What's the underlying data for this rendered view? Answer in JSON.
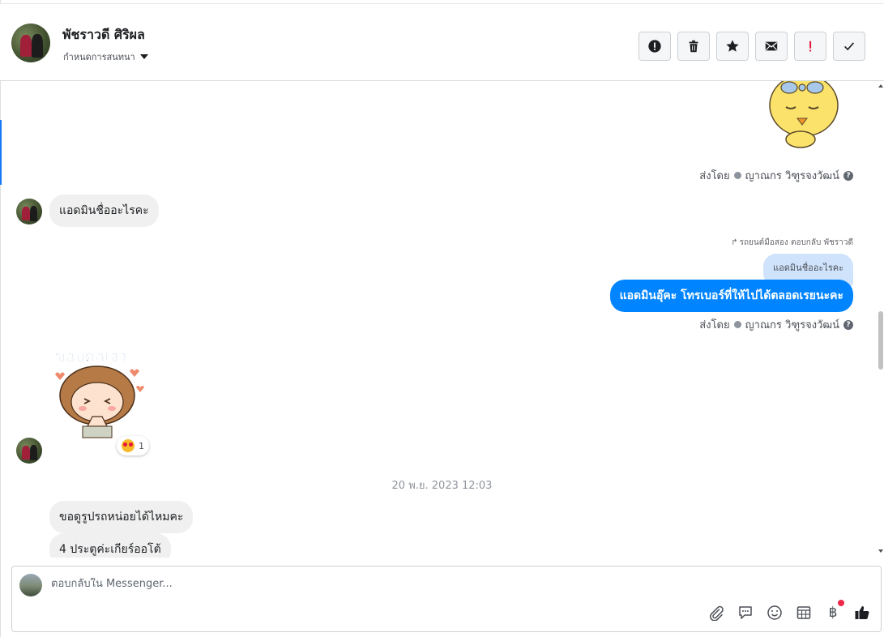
{
  "header": {
    "contact_name": "พัชราวดี ศิริผล",
    "assign_label": "กำหนดการสนทนา",
    "actions": [
      {
        "name": "report-button",
        "icon": "exclamation-circle-icon"
      },
      {
        "name": "delete-button",
        "icon": "trash-icon"
      },
      {
        "name": "star-button",
        "icon": "star-icon"
      },
      {
        "name": "mark-unread-button",
        "icon": "envelope-icon"
      },
      {
        "name": "follow-up-button",
        "icon": "exclamation-mark-icon"
      },
      {
        "name": "mark-done-button",
        "icon": "check-icon"
      }
    ]
  },
  "messages": {
    "sent_by_1": "ส่งโดย",
    "sender_1": "ญาณกร วิฑูรจงวัฒน์",
    "incoming_1": "แอดมินชื่ออะไรคะ",
    "reply_meta": "รถยนต์มือสอง ตอบกลับ พัชราวดี",
    "quoted_text": "แอดมินชื่ออะไรคะ",
    "outgoing_1": "แอดมินอุ๊คะ โทรเบอร์ที่ให้ไปได้ตลอดเรยนะคะ",
    "sent_by_2": "ส่งโดย",
    "sender_2": "ญาณกร วิฑูรจงวัฒน์",
    "sticker_caption": "ขอบคุณจ้า",
    "reaction_count": "1",
    "timestamp": "20 พ.ย. 2023 12:03",
    "incoming_2": "ขอดูรูปรถหน่อยได้ไหมคะ",
    "incoming_3": "4 ประตูค่ะเกียร์ออโต้"
  },
  "composer": {
    "placeholder": "ตอบกลับใน Messenger...",
    "tools": [
      "paperclip-icon",
      "chat-bubble-icon",
      "smiley-icon",
      "calendar-grid-icon",
      "baht-icon",
      "thumbs-up-icon"
    ],
    "baht_symbol": "฿"
  },
  "colors": {
    "outgoing_bubble": "#0084ff",
    "incoming_bubble": "#f0f0f0",
    "quoted_bubble": "#cfe3fc",
    "follow_up_red": "#e4163a",
    "accent": "#1877f2"
  }
}
